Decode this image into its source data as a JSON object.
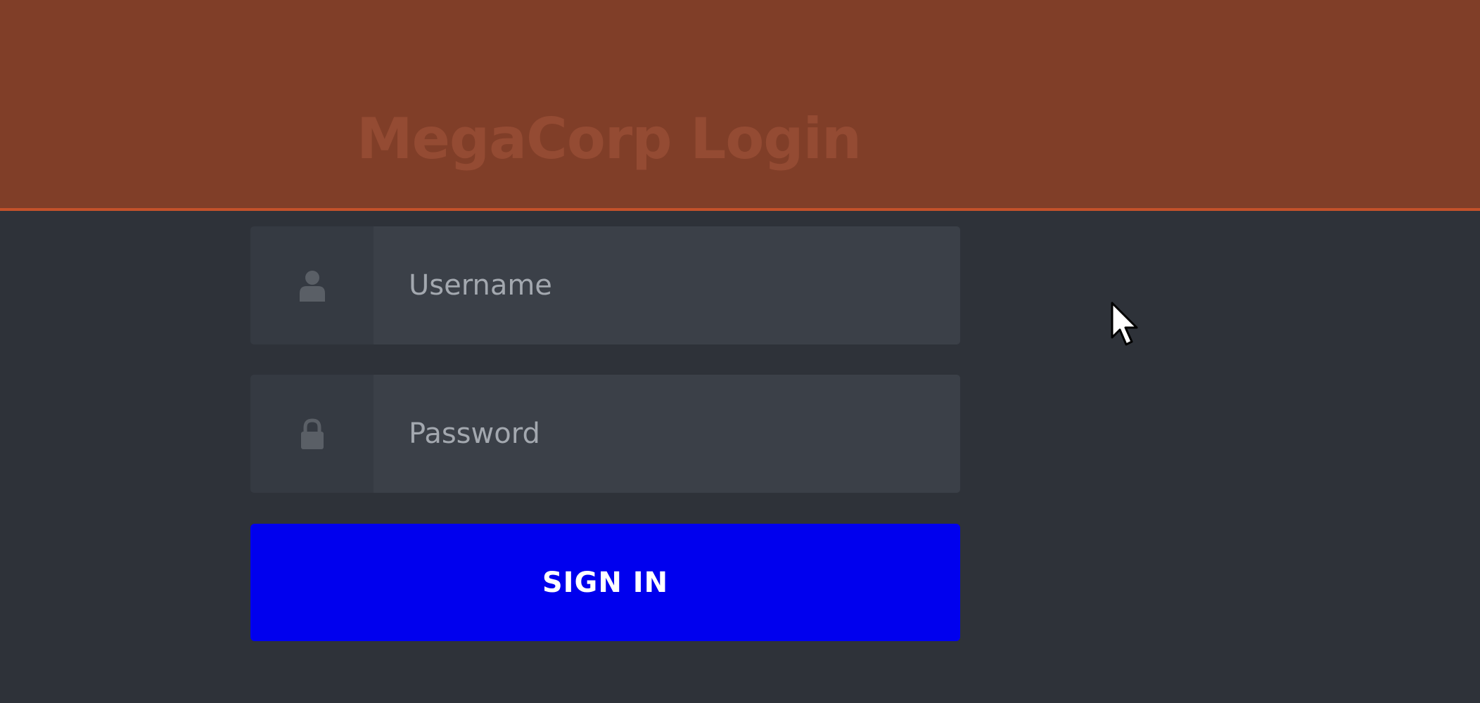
{
  "header": {
    "title": "MegaCorp Login"
  },
  "form": {
    "username": {
      "placeholder": "Username",
      "value": "",
      "icon": "user-icon"
    },
    "password": {
      "placeholder": "Password",
      "value": "",
      "icon": "lock-icon"
    },
    "submit_label": "SIGN IN"
  },
  "colors": {
    "header_bg": "#803e28",
    "header_border": "#c4512a",
    "title": "#944b33",
    "page_bg": "#2e3239",
    "input_bg": "#3b4048",
    "icon_box_bg": "#353a42",
    "button_bg": "#0000ee",
    "button_text": "#ffffff"
  }
}
